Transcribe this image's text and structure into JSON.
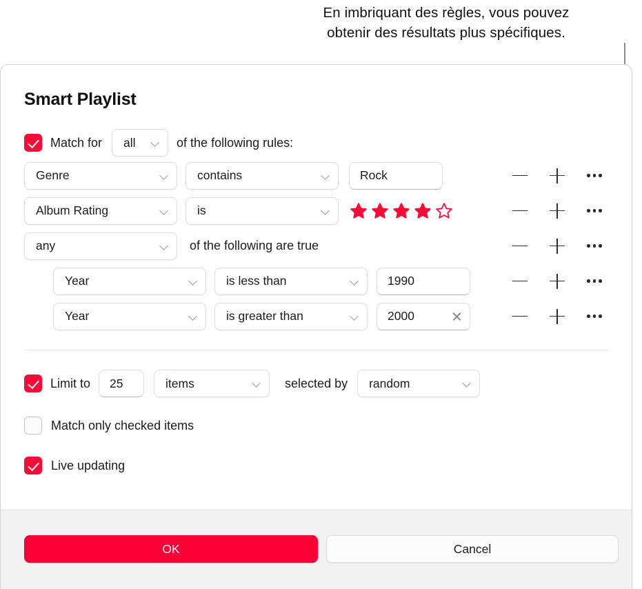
{
  "callout": {
    "line1": "En imbriquant des règles, vous pouvez",
    "line2": "obtenir des résultats plus spécifiques."
  },
  "dialog": {
    "title": "Smart Playlist",
    "match": {
      "checked": true,
      "label_before": "Match  for",
      "selected": "all",
      "label_after": "of the following rules:"
    },
    "rules": [
      {
        "field": "Genre",
        "operator": "contains",
        "value": "Rock",
        "value_kind": "text",
        "nested": false,
        "clearable": false
      },
      {
        "field": "Album Rating",
        "operator": "is",
        "value_kind": "stars",
        "stars_filled": 4,
        "stars_total": 5,
        "nested": false,
        "clearable": false
      },
      {
        "field": "any",
        "value_kind": "group",
        "group_label": "of the following are true",
        "nested": false,
        "clearable": false
      },
      {
        "field": "Year",
        "operator": "is less than",
        "value": "1990",
        "value_kind": "text",
        "nested": true,
        "clearable": false
      },
      {
        "field": "Year",
        "operator": "is greater than",
        "value": "2000",
        "value_kind": "text",
        "nested": true,
        "clearable": true
      }
    ],
    "row_actions": {
      "remove": "remove-rule",
      "add": "add-rule",
      "more": "more-options"
    },
    "limit": {
      "checked": true,
      "label": "Limit to",
      "amount": "25",
      "unit": "items",
      "selected_by_label": "selected by",
      "selected_by": "random"
    },
    "match_only_checked": {
      "checked": false,
      "label": "Match only checked items"
    },
    "live_updating": {
      "checked": true,
      "label": "Live updating"
    },
    "footer": {
      "ok": "OK",
      "cancel": "Cancel"
    }
  },
  "colors": {
    "accent_red": "#FA0A37",
    "ok_button_red": "#FA0037",
    "star_red": "#FA0A37",
    "footer_bg": "#F2F2F2",
    "callout_line": "#8C8C8C"
  }
}
